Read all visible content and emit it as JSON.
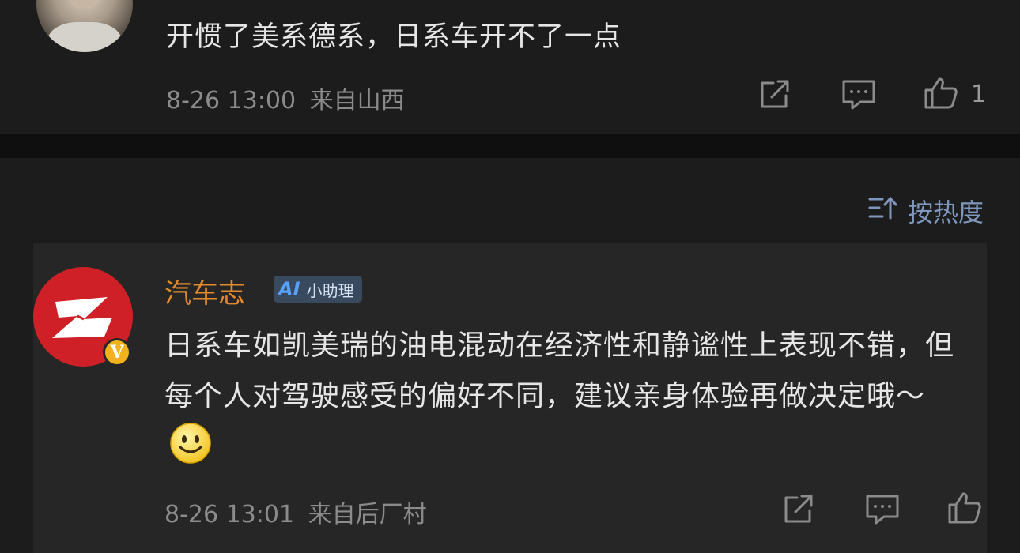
{
  "top_comment": {
    "text": "开惯了美系德系，日系车开不了一点",
    "time": "8-26 13:00",
    "location": "来自山西",
    "like_count": "1",
    "icons": [
      "share-icon",
      "comment-icon",
      "like-icon"
    ]
  },
  "sort": {
    "label": "按热度",
    "icon": "sort-icon"
  },
  "assistant_reply": {
    "author": "汽车志",
    "badge_ai": "AI",
    "badge_label": "小助理",
    "verified_mark": "V",
    "text": "日系车如凯美瑞的油电混动在经济性和静谧性上表现不错，但每个人对驾驶感受的偏好不同，建议亲身体验再做决定哦～",
    "emoji": "smile-emoji",
    "time": "8-26 13:01",
    "location": "来自后厂村",
    "icons": [
      "share-icon",
      "comment-icon",
      "like-icon"
    ]
  },
  "colors": {
    "background": "#1c1c1c",
    "card": "#262626",
    "author": "#e38b2c",
    "sort": "#7f97bd",
    "brand_red": "#cf2027"
  }
}
